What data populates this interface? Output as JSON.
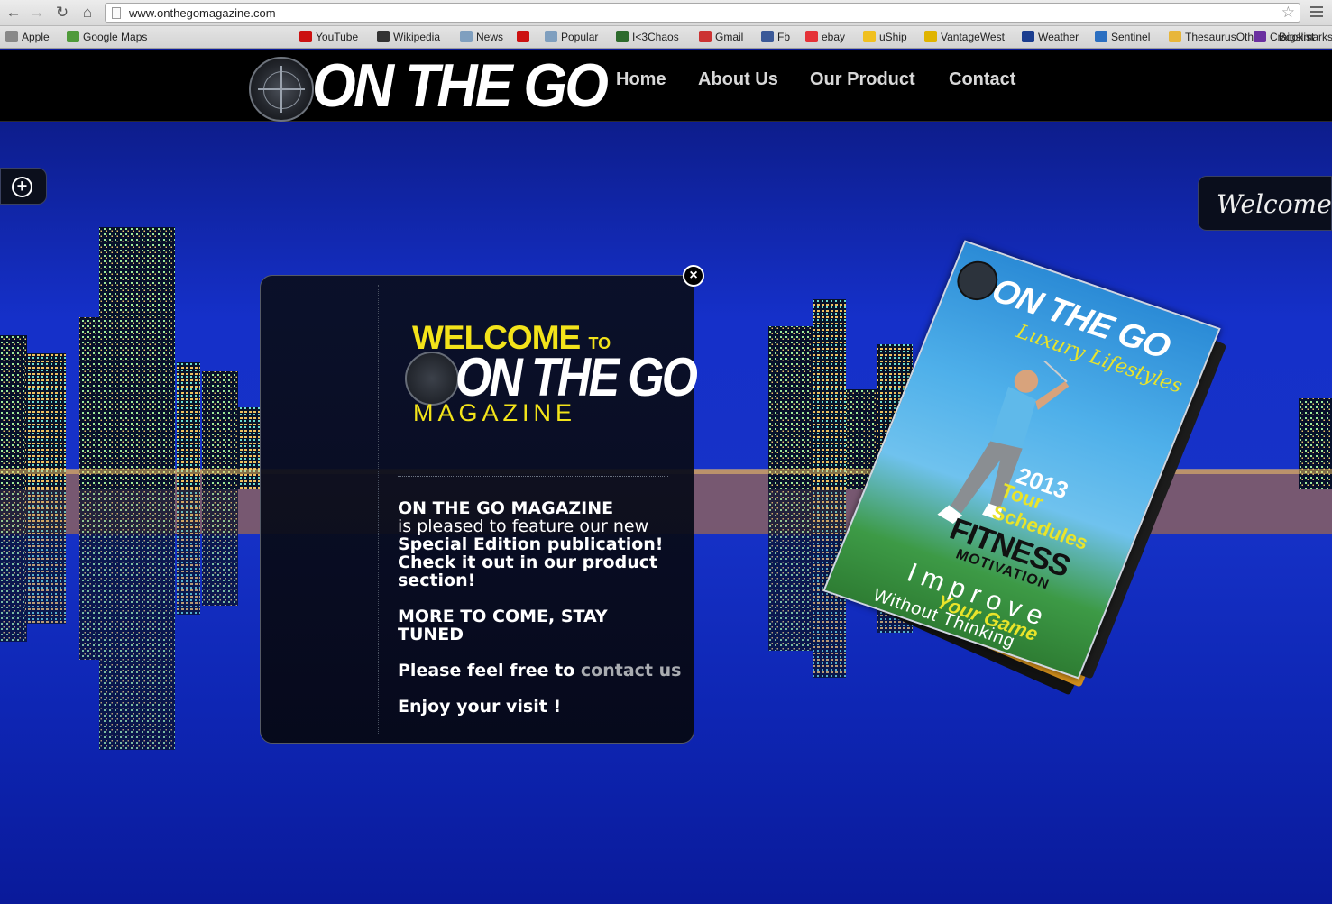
{
  "browser": {
    "url": "www.onthegomagazine.com",
    "bookmarks": [
      {
        "label": "Apple",
        "icon": "apple-icon",
        "color": "#888888"
      },
      {
        "label": "Google Maps",
        "icon": "maps-icon",
        "color": "#4f9a3a"
      },
      {
        "label": "YouTube",
        "icon": "youtube-icon",
        "color": "#cc1111"
      },
      {
        "label": "Wikipedia",
        "icon": "wikipedia-icon",
        "color": "#333333"
      },
      {
        "label": "News",
        "icon": "folder-icon",
        "color": "#7f9fbf"
      },
      {
        "label": "",
        "icon": "youtube-icon",
        "color": "#cc1111"
      },
      {
        "label": "Popular",
        "icon": "folder-icon",
        "color": "#7f9fbf"
      },
      {
        "label": "I<3Chaos",
        "icon": "chaos-icon",
        "color": "#2d6b2d"
      },
      {
        "label": "Gmail",
        "icon": "gmail-icon",
        "color": "#cc3333"
      },
      {
        "label": "Fb",
        "icon": "facebook-icon",
        "color": "#3b5998"
      },
      {
        "label": "ebay",
        "icon": "ebay-icon",
        "color": "#e53238"
      },
      {
        "label": "uShip",
        "icon": "uship-icon",
        "color": "#f0c020"
      },
      {
        "label": "VantageWest",
        "icon": "vantagewest-icon",
        "color": "#e0b400"
      },
      {
        "label": "Weather",
        "icon": "weather-icon",
        "color": "#1b3d8f"
      },
      {
        "label": "Sentinel",
        "icon": "sentinel-icon",
        "color": "#2b6fc1"
      },
      {
        "label": "ThesaurusOth",
        "icon": "thesaurus-icon",
        "color": "#e8b63a"
      },
      {
        "label": "Craigslist",
        "icon": "craigslist-icon",
        "color": "#6a2fa0"
      },
      {
        "label": "Bookmarks",
        "icon": "bookmarks-icon",
        "color": "#888888"
      }
    ]
  },
  "site": {
    "logo_text": "ON THE GO",
    "nav": [
      {
        "label": "Home"
      },
      {
        "label": "About Us"
      },
      {
        "label": "Our Product"
      },
      {
        "label": "Contact"
      }
    ],
    "welcome_tab": "Welcome"
  },
  "popup": {
    "welcome": "WELCOME",
    "to": "TO",
    "brand": "ON THE GO",
    "magazine": "MAGAZINE",
    "line1": "ON THE GO MAGAZINE",
    "line2": "is pleased to feature our new",
    "line3": "Special Edition publication!",
    "line4": "Check it out in our product",
    "line5": "section!",
    "line6": "MORE TO COME, STAY",
    "line7": "TUNED",
    "line8_prefix": "Please feel free to",
    "line8_link": "contact us",
    "line9": "Enjoy your visit !"
  },
  "magazine_cover": {
    "title": "ON THE GO",
    "subtitle": "Luxury Lifestyles",
    "year": "2013",
    "tour": "Tour Schedules",
    "fitness": "FITNESS",
    "motivation": "MOTIVATION",
    "improve": "Improve",
    "your_game": "Your Game",
    "without": "Without Thinking"
  },
  "colors": {
    "accent_yellow": "#f3e31a",
    "sky_blue": "#1632c8",
    "header_black": "#000000"
  }
}
